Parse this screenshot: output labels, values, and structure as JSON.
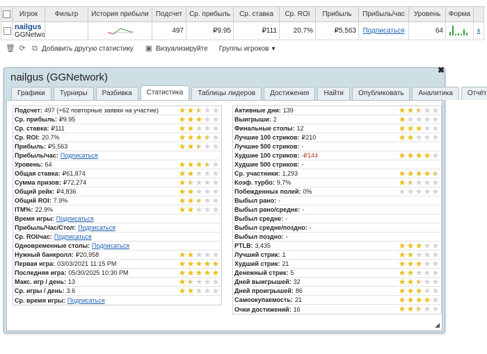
{
  "table": {
    "headers": [
      "Игрок",
      "Фильтр",
      "История прибыли",
      "Подсчет",
      "Ср. прибыль",
      "Ср. ставка",
      "Ср. ROI",
      "Прибыль",
      "Прибыль/час",
      "Уровень",
      "Форма"
    ],
    "row": {
      "player": "nailgus",
      "network": "GGNetwork",
      "count": "497",
      "avg_profit": "₽9.95",
      "avg_stake": "₽111",
      "avg_roi": "20.7%",
      "profit": "₽5,563",
      "profit_hour": "Подписаться",
      "level": "64",
      "remove": "x"
    }
  },
  "toolbar": {
    "add_stat": "Добавить другую статистику",
    "visualize": "Визуализируйте",
    "groups": "Группы игроков"
  },
  "popup": {
    "title": "nailgus (GGNetwork)",
    "tabs": [
      "Графики",
      "Турниры",
      "Разбивка",
      "Статистика",
      "Таблицы лидеров",
      "Достижения",
      "Найти",
      "Опубликовать",
      "Аналитика",
      "Отчёты"
    ],
    "active_tab": "Статистика"
  },
  "stats_left": [
    {
      "label": "Подсчет:",
      "value": "497 (+62 повторные заявки на участие)",
      "stars": 2.5
    },
    {
      "label": "Ср. прибыль:",
      "value": "₽9.95",
      "stars": 3
    },
    {
      "label": "Ср. ставка:",
      "value": "₽111",
      "stars": 2
    },
    {
      "label": "Ср. ROI:",
      "value": "20.7%",
      "stars": 3.5
    },
    {
      "label": "Прибыль:",
      "value": "₽5,563",
      "stars": 2.5
    },
    {
      "label": "Прибыль/час:",
      "value": "Подписаться",
      "link": true
    },
    {
      "label": "Уровень:",
      "value": "64",
      "stars": 3.5
    },
    {
      "label": "Общая ставка:",
      "value": "₽61,874",
      "stars": 2
    },
    {
      "label": "Сумма призов:",
      "value": "₽72,274",
      "stars": 1.5
    },
    {
      "label": "Общий рейк:",
      "value": "₽4,836",
      "stars": 2
    },
    {
      "label": "Общий ROI:",
      "value": "7.9%",
      "stars": 2.5
    },
    {
      "label": "ITM%:",
      "value": "22.9%",
      "stars": 2
    },
    {
      "label": "Время игры:",
      "value": "Подписаться",
      "link": true
    },
    {
      "label": "Прибыль/Час/Стол:",
      "value": "Подписаться",
      "link": true
    },
    {
      "label": "Ср. ROI/час:",
      "value": "Подписаться",
      "link": true
    },
    {
      "label": "Одновременные столы:",
      "value": "Подписаться",
      "link": true
    },
    {
      "label": "Нужный банкролл:",
      "value": "₽20,958",
      "stars": 2
    },
    {
      "label": "Первая игра:",
      "value": "03/03/2021 11:15 PM",
      "stars": 5
    },
    {
      "label": "Последняя игра:",
      "value": "05/30/2025 10:30 PM",
      "stars": 5
    },
    {
      "label": "Макс. игр / день:",
      "value": "13",
      "stars": 1.5
    },
    {
      "label": "Ср. игры / день:",
      "value": "3.6",
      "stars": 2
    },
    {
      "label": "Ср. время игры:",
      "value": "Подписаться",
      "link": true
    }
  ],
  "stats_right": [
    {
      "label": "Активные дни:",
      "value": "139",
      "stars": 2.5
    },
    {
      "label": "Выигрыши:",
      "value": "2",
      "stars": 1
    },
    {
      "label": "Финальные столы:",
      "value": "12",
      "stars": 3
    },
    {
      "label": "Лучшие 100 стриков:",
      "value": "₽210",
      "stars": 2
    },
    {
      "label": "Лучшие 500 стриков:",
      "value": "-"
    },
    {
      "label": "Худшие 100 стриков:",
      "value": "-₽144",
      "neg": true,
      "stars": 4
    },
    {
      "label": "Худшие 500 стриков:",
      "value": "-"
    },
    {
      "label": "Ср. участники:",
      "value": "1,293",
      "stars": 4.5
    },
    {
      "label": "Коэф. турбо:",
      "value": "9.7%",
      "stars": 1.5
    },
    {
      "label": "Побежденных полей:",
      "value": "0%",
      "stars": 0
    },
    {
      "label": "Выбыл рано:",
      "value": "-"
    },
    {
      "label": "Выбыл рано/средне:",
      "value": "-"
    },
    {
      "label": "Выбыл средне:",
      "value": "-"
    },
    {
      "label": "Выбыл средне/поздно:",
      "value": "-"
    },
    {
      "label": "Выбыл поздно:",
      "value": "-"
    },
    {
      "label": "PTLB:",
      "value": "3,435",
      "stars": 3
    },
    {
      "label": "Лучший стрик:",
      "value": "1",
      "stars": 2
    },
    {
      "label": "Худший стрик:",
      "value": "21",
      "stars": 3
    },
    {
      "label": "Денежный стрик:",
      "value": "5",
      "stars": 2
    },
    {
      "label": "Дней выигрышей:",
      "value": "32",
      "stars": 2.5
    },
    {
      "label": "Дней проигрышей:",
      "value": "86",
      "stars": 3
    },
    {
      "label": "Самоокупаемость:",
      "value": "21",
      "stars": 4
    },
    {
      "label": "Очки достижений:",
      "value": "16",
      "stars": 2.5
    }
  ],
  "colors": {
    "star_filled": "#e8c020",
    "star_empty": "#d4d4d4",
    "popup_bg": "#cfdfe6",
    "link": "#1a5fb4",
    "negative": "#c0392b"
  }
}
